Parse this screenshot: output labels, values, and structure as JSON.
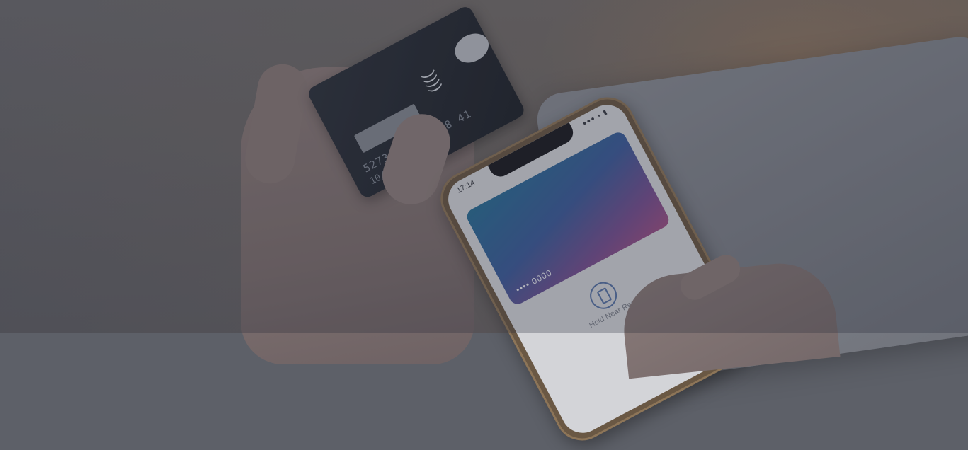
{
  "image": {
    "subject": "contactless payment",
    "card": {
      "number": "5273 4607 1428 41",
      "expiry": "10/24",
      "contactless_symbol": "))))"
    },
    "phone": {
      "status_time": "17:14",
      "status_icons": "●●● ◗ ▮",
      "wallet_card_number": "•••• 0000",
      "prompt": "Hold Near Reader"
    }
  },
  "colors": {
    "overlay": "#23283a",
    "card": "#2a2f37",
    "wallet_gradient_start": "#2a6f95",
    "wallet_gradient_end": "#9e4f84",
    "reader_icon": "#5873a6"
  }
}
